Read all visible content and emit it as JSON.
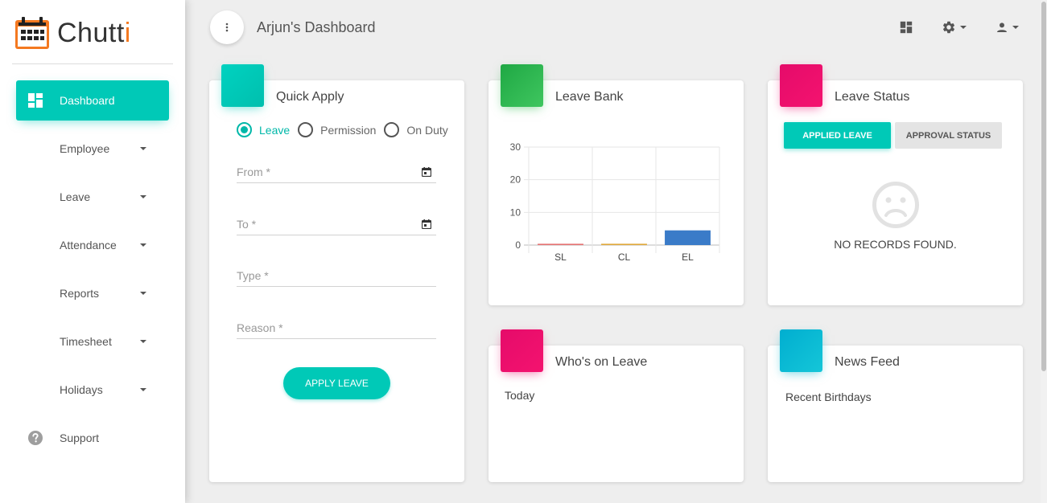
{
  "brand": {
    "name_main": "Chutt",
    "name_accent": "i",
    "accent_color": "#f47920"
  },
  "sidebar": {
    "items": [
      {
        "label": "Dashboard",
        "icon": "dashboard-icon",
        "active": true
      },
      {
        "label": "Employee",
        "dropdown": true
      },
      {
        "label": "Leave",
        "dropdown": true
      },
      {
        "label": "Attendance",
        "dropdown": true
      },
      {
        "label": "Reports",
        "dropdown": true
      },
      {
        "label": "Timesheet",
        "dropdown": true
      },
      {
        "label": "Holidays",
        "dropdown": true
      },
      {
        "label": "Support",
        "icon": "help-icon"
      }
    ]
  },
  "header": {
    "title": "Arjun's Dashboard"
  },
  "quick_apply": {
    "title": "Quick Apply",
    "options": [
      "Leave",
      "Permission",
      "On Duty"
    ],
    "selected": "Leave",
    "fields": {
      "from": "From *",
      "to": "To *",
      "type": "Type *",
      "reason": "Reason *"
    },
    "button": "APPLY LEAVE",
    "color": "#00c9b7"
  },
  "leave_bank": {
    "title": "Leave Bank",
    "color": "#2db84c",
    "chart_data": {
      "type": "bar",
      "categories": [
        "SL",
        "CL",
        "EL"
      ],
      "values": [
        0.4,
        0.4,
        4.5
      ],
      "colors": [
        "#e57373",
        "#e0a93c",
        "#3a7bc8"
      ],
      "yticks": [
        0,
        10,
        20,
        30
      ],
      "ylim": [
        0,
        30
      ]
    }
  },
  "leave_status": {
    "title": "Leave Status",
    "color": "#ec0a6c",
    "tabs": [
      "APPLIED LEAVE",
      "APPROVAL STATUS"
    ],
    "empty_text": "NO RECORDS FOUND."
  },
  "whos_on_leave": {
    "title": "Who's on Leave",
    "color": "#ec0a6c",
    "subtitle": "Today"
  },
  "news_feed": {
    "title": "News Feed",
    "color": "#00b5cc",
    "subtitle": "Recent Birthdays"
  }
}
